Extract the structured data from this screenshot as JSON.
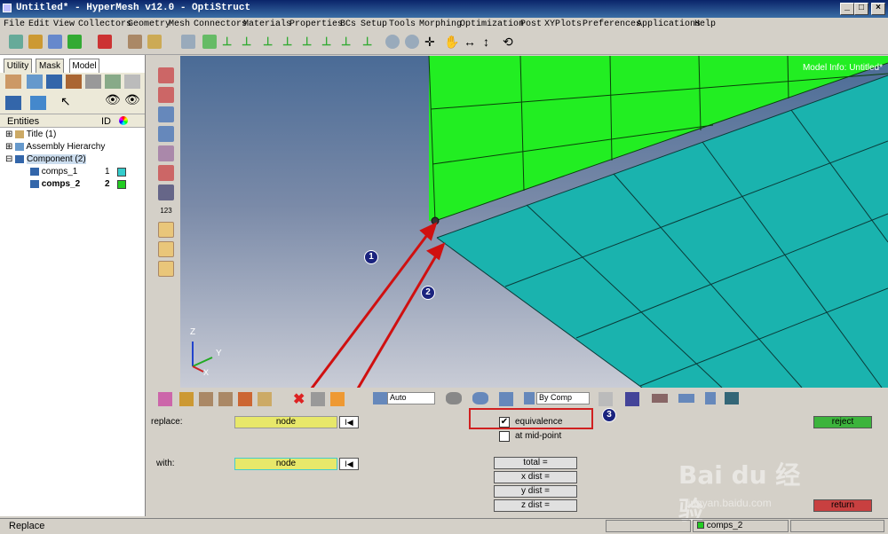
{
  "window": {
    "title": "Untitled* - HyperMesh v12.0 - OptiStruct",
    "minimize": "_",
    "maximize": "□",
    "close": "×"
  },
  "menu": [
    "File",
    "Edit",
    "View",
    "Collectors",
    "Geometry",
    "Mesh",
    "Connectors",
    "Materials",
    "Properties",
    "BCs",
    "Setup",
    "Tools",
    "Morphing",
    "Optimization",
    "Post",
    "XYPlots",
    "Preferences",
    "Applications",
    "Help"
  ],
  "tabs": {
    "utility": "Utility",
    "mask": "Mask",
    "model": "Model"
  },
  "entities": {
    "header_entities": "Entities",
    "header_id": "ID",
    "rows": [
      {
        "label": "Title (1)",
        "id": "",
        "color": ""
      },
      {
        "label": "Assembly Hierarchy",
        "id": "",
        "color": ""
      },
      {
        "label": "Component (2)",
        "id": "",
        "color": ""
      },
      {
        "label": "comps_1",
        "id": "1",
        "color": "#33cccc"
      },
      {
        "label": "comps_2",
        "id": "2",
        "color": "#22cc22"
      }
    ]
  },
  "vt_label": "123",
  "viewport": {
    "model_info": "Model Info: Untitled*",
    "axis_z": "Z",
    "axis_y": "Y",
    "axis_x": "X"
  },
  "annot": {
    "c1": "1",
    "c2": "2",
    "c3": "3"
  },
  "bottom_tools": {
    "auto": "Auto",
    "bycomp": "By Comp"
  },
  "panel": {
    "replace_label": "replace:",
    "with_label": "with:",
    "node1": "node",
    "node2": "node",
    "reset1": "I◀",
    "reset2": "I◀",
    "equivalence": "equivalence",
    "midpoint": "at mid-point",
    "total": "total =",
    "xdist": "x dist =",
    "ydist": "y dist =",
    "zdist": "z dist =",
    "reject": "reject",
    "return": "return"
  },
  "status": {
    "mode": "Replace",
    "component": "comps_2",
    "component_color": "#22cc22"
  },
  "watermark": {
    "logo": "Bai du 经验",
    "url": "jingyan.baidu.com"
  },
  "colors": {
    "green_comp": "#22ee22",
    "teal_comp": "#1ab3ae",
    "accent": "#0a246a"
  }
}
